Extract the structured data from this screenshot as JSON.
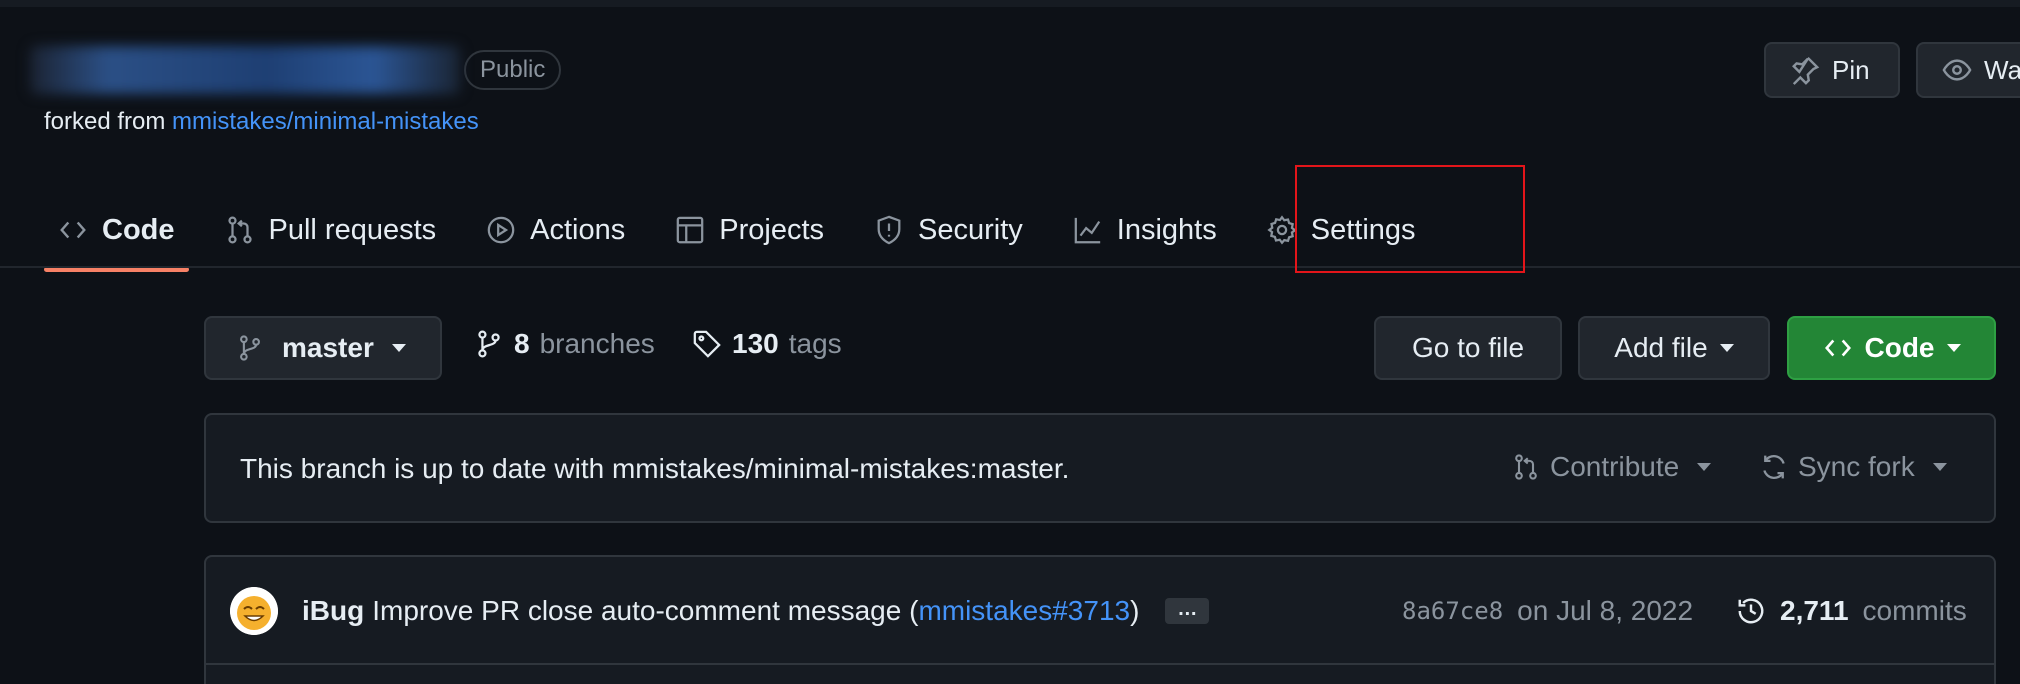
{
  "repo": {
    "visibility": "Public",
    "forked_prefix": "forked from",
    "forked_source": "mmistakes/minimal-mistakes"
  },
  "header_buttons": {
    "pin": "Pin",
    "watch": "Wat"
  },
  "tabs": [
    {
      "label": "Code",
      "icon": "code-icon",
      "selected": true
    },
    {
      "label": "Pull requests",
      "icon": "pull-request-icon"
    },
    {
      "label": "Actions",
      "icon": "play-icon"
    },
    {
      "label": "Projects",
      "icon": "table-icon"
    },
    {
      "label": "Security",
      "icon": "shield-icon"
    },
    {
      "label": "Insights",
      "icon": "graph-icon"
    },
    {
      "label": "Settings",
      "icon": "gear-icon"
    }
  ],
  "branch": {
    "current": "master",
    "branches_count": "8",
    "branches_label": "branches",
    "tags_count": "130",
    "tags_label": "tags"
  },
  "actions": {
    "go_to_file": "Go to file",
    "add_file": "Add file",
    "code": "Code"
  },
  "sync": {
    "message": "This branch is up to date with mmistakes/minimal-mistakes:master.",
    "contribute": "Contribute",
    "sync_fork": "Sync fork"
  },
  "latest_commit": {
    "author": "iBug",
    "message": "Improve PR close auto-comment message (",
    "pr_ref": "mmistakes#3713",
    "message_end": ")",
    "ellipsis": "…",
    "sha": "8a67ce8",
    "date": "on Jul 8, 2022",
    "commits_count": "2,711",
    "commits_label": "commits"
  },
  "colors": {
    "background": "#0d1117",
    "accent_link": "#4493f8",
    "tab_underline": "#f78166",
    "code_button": "#238636",
    "highlight_box": "#e3151a"
  }
}
